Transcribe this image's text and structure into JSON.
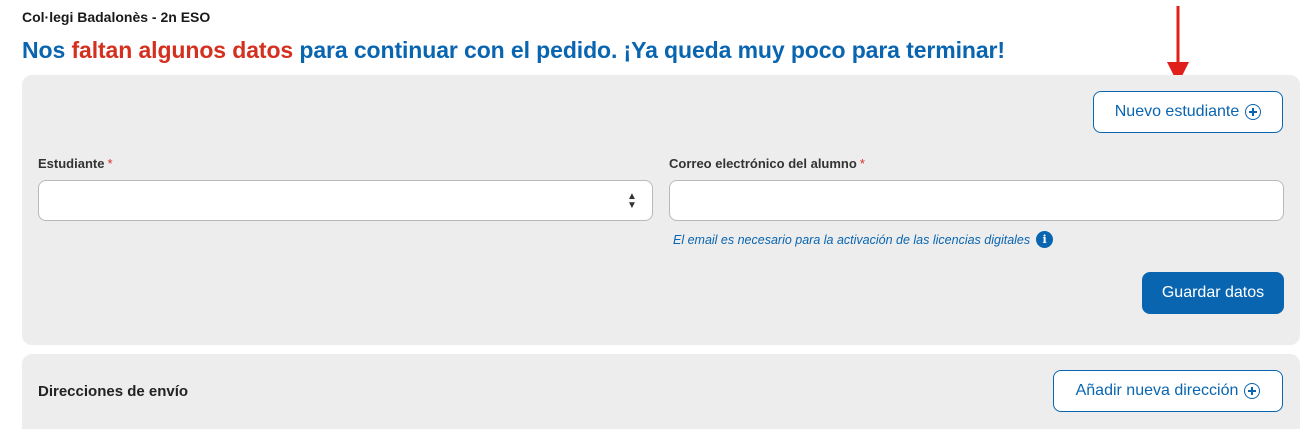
{
  "header": {
    "school": "Col·legi Badalonès - 2n ESO",
    "headline_prefix": "Nos",
    "headline_highlight": "faltan algunos datos",
    "headline_suffix": "para continuar con el pedido. ¡Ya queda muy poco para terminar!"
  },
  "student_panel": {
    "new_student_label": "Nuevo estudiante",
    "student_label": "Estudiante",
    "email_label": "Correo electrónico del alumno",
    "required_mark": "*",
    "student_value": "",
    "email_value": "",
    "helper_text": "El email es necesario para la activación de las licencias digitales",
    "info_glyph": "i",
    "save_label": "Guardar datos"
  },
  "address_panel": {
    "title": "Direcciones de envío",
    "add_label": "Añadir nueva dirección"
  },
  "icons": {
    "plus": "plus-circle-icon",
    "chevron": "chevron-up-down-icon",
    "info": "info-icon",
    "arrow": "red-down-arrow"
  },
  "colors": {
    "primary": "#0a65b0",
    "highlight": "#d4301f",
    "panel_bg": "#ededed"
  }
}
